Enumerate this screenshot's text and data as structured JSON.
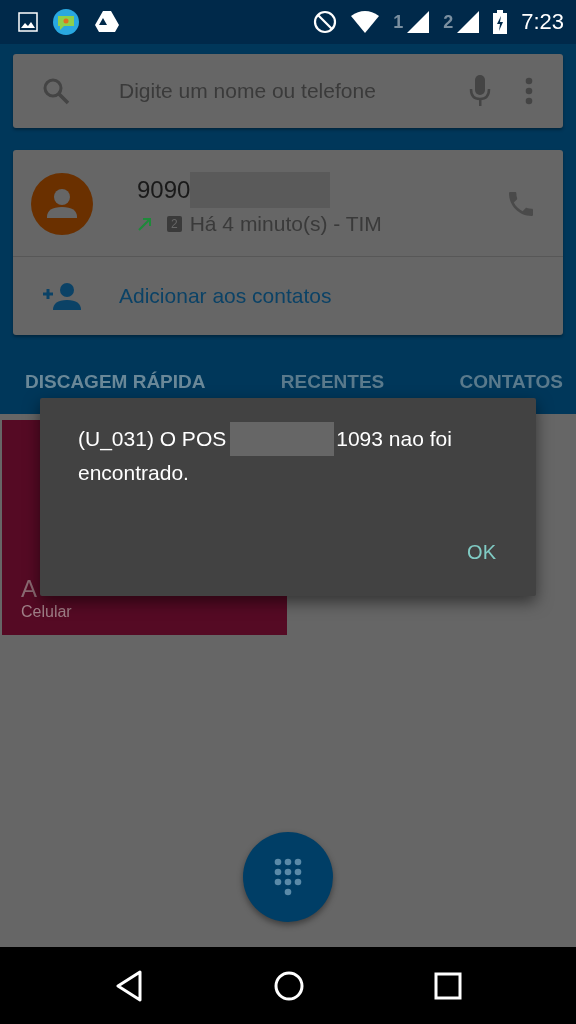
{
  "status_bar": {
    "time": "7:23",
    "sim_labels": [
      "1",
      "2"
    ]
  },
  "search": {
    "placeholder": "Digite um nome ou telefone"
  },
  "recent_call": {
    "number": "9090",
    "detail": "Há 4 minuto(s) - TIM",
    "sim_badge": "2",
    "add_contact": "Adicionar aos contatos"
  },
  "tabs": [
    {
      "label": "DISCAGEM RÁPIDA",
      "selected": true
    },
    {
      "label": "RECENTES",
      "selected": false
    },
    {
      "label": "CONTATOS",
      "selected": false
    }
  ],
  "speed_dial": [
    {
      "name": "A",
      "type": "Celular"
    }
  ],
  "dialog": {
    "message_lines": [
      [
        "(U_031) O POS",
        "1093 nao foi"
      ],
      [
        "encontrado."
      ]
    ],
    "button": "OK"
  }
}
